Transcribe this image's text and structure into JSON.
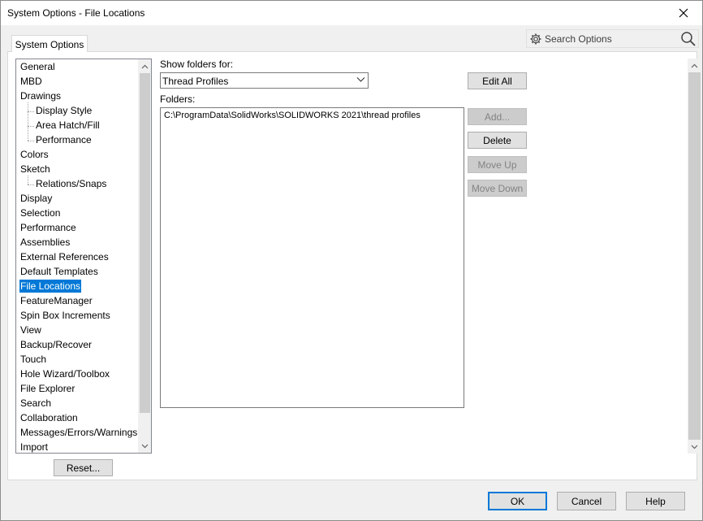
{
  "window": {
    "title": "System Options - File Locations"
  },
  "tabs": [
    {
      "label": "System Options"
    }
  ],
  "search": {
    "placeholder": "Search Options"
  },
  "tree": {
    "items": [
      {
        "label": "General",
        "level": 0
      },
      {
        "label": "MBD",
        "level": 0
      },
      {
        "label": "Drawings",
        "level": 0
      },
      {
        "label": "Display Style",
        "level": 1
      },
      {
        "label": "Area Hatch/Fill",
        "level": 1
      },
      {
        "label": "Performance",
        "level": 1
      },
      {
        "label": "Colors",
        "level": 0
      },
      {
        "label": "Sketch",
        "level": 0
      },
      {
        "label": "Relations/Snaps",
        "level": 1
      },
      {
        "label": "Display",
        "level": 0
      },
      {
        "label": "Selection",
        "level": 0
      },
      {
        "label": "Performance",
        "level": 0
      },
      {
        "label": "Assemblies",
        "level": 0
      },
      {
        "label": "External References",
        "level": 0
      },
      {
        "label": "Default Templates",
        "level": 0
      },
      {
        "label": "File Locations",
        "level": 0,
        "selected": true
      },
      {
        "label": "FeatureManager",
        "level": 0
      },
      {
        "label": "Spin Box Increments",
        "level": 0
      },
      {
        "label": "View",
        "level": 0
      },
      {
        "label": "Backup/Recover",
        "level": 0
      },
      {
        "label": "Touch",
        "level": 0
      },
      {
        "label": "Hole Wizard/Toolbox",
        "level": 0
      },
      {
        "label": "File Explorer",
        "level": 0
      },
      {
        "label": "Search",
        "level": 0
      },
      {
        "label": "Collaboration",
        "level": 0
      },
      {
        "label": "Messages/Errors/Warnings",
        "level": 0
      },
      {
        "label": "Import",
        "level": 0
      }
    ]
  },
  "reset_label": "Reset...",
  "show_folders_label": "Show folders for:",
  "show_folders_value": "Thread Profiles",
  "folders_label": "Folders:",
  "folders": [
    "C:\\ProgramData\\SolidWorks\\SOLIDWORKS 2021\\thread profiles"
  ],
  "buttons": {
    "edit_all": "Edit All",
    "add": "Add...",
    "delete": "Delete",
    "move_up": "Move Up",
    "move_down": "Move Down"
  },
  "footer": {
    "ok": "OK",
    "cancel": "Cancel",
    "help": "Help"
  },
  "colors": {
    "selection": "#0078d7",
    "default_button_border": "#0078d7"
  },
  "icons": {
    "close": "close-icon",
    "gear": "gear-icon",
    "search": "search-icon",
    "dropdown": "chevron-down-icon"
  }
}
